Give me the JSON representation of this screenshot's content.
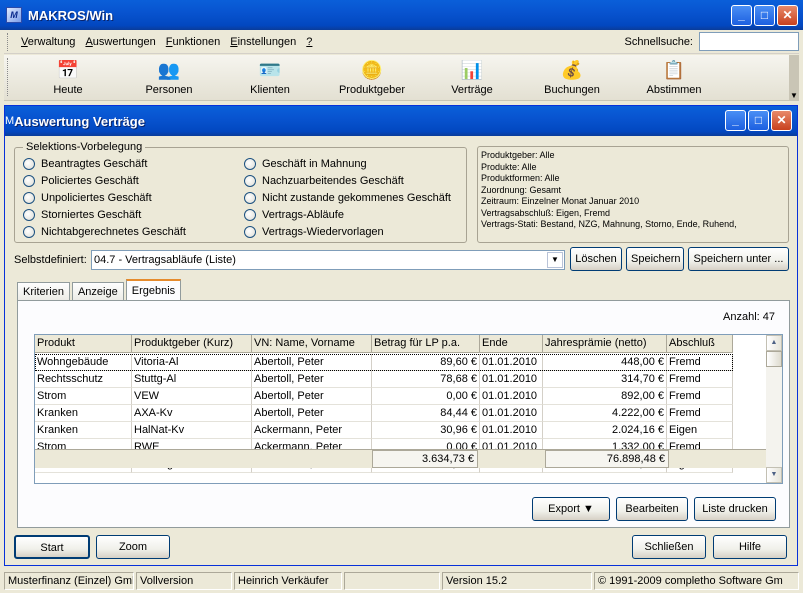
{
  "app": {
    "title": "MAKROS/Win",
    "icon": "makros-app-icon"
  },
  "menu": {
    "items": [
      {
        "label": "Verwaltung",
        "key": "V",
        "rest": "erwaltung"
      },
      {
        "label": "Auswertungen",
        "key": "A",
        "rest": "uswertungen"
      },
      {
        "label": "Funktionen",
        "key": "F",
        "rest": "unktionen"
      },
      {
        "label": "Einstellungen",
        "key": "E",
        "rest": "instellungen"
      },
      {
        "label": "?",
        "key": "?",
        "rest": ""
      }
    ],
    "quicksearch_label": "Schnellsuche:",
    "quicksearch_value": ""
  },
  "toolbar": {
    "items": [
      {
        "label": "Heute",
        "icon": "calendar-clock-icon"
      },
      {
        "label": "Personen",
        "icon": "people-icon"
      },
      {
        "label": "Klienten",
        "icon": "id-card-icon"
      },
      {
        "label": "Produktgeber",
        "icon": "coins-stack-icon"
      },
      {
        "label": "Verträge",
        "icon": "chart-document-icon"
      },
      {
        "label": "Buchungen",
        "icon": "money-icon"
      },
      {
        "label": "Abstimmen",
        "icon": "checklist-icon"
      }
    ]
  },
  "child": {
    "title": "Auswertung Verträge",
    "selection_legend": "Selektions-Vorbelegung",
    "radios_left": [
      "Beantragtes Geschäft",
      "Policiertes Geschäft",
      "Unpoliciertes Geschäft",
      "Storniertes Geschäft",
      "Nichtabgerechnetes Geschäft"
    ],
    "radios_right": [
      "Geschäft in Mahnung",
      "Nachzuarbeitendes Geschäft",
      "Nicht zustande gekommenes Geschäft",
      "Vertrags-Abläufe",
      "Vertrags-Wiedervorlagen"
    ],
    "summary": [
      "Produktgeber: Alle",
      "Produkte: Alle",
      "Produktformen: Alle",
      "Zuordnung: Gesamt",
      "Zeitraum: Einzelner Monat Januar 2010",
      "Vertragsabschluß: Eigen, Fremd",
      "Vertrags-Stati: Bestand, NZG, Mahnung, Storno, Ende, Ruhend,"
    ],
    "selbstdefiniert_label": "Selbstdefiniert:",
    "selbstdefiniert_value": "04.7 - Vertragsabläufe (Liste)",
    "btn_loeschen": "Löschen",
    "btn_speichern": "Speichern",
    "btn_speichern_unter": "Speichern unter ...",
    "tabs": [
      "Kriterien",
      "Anzeige",
      "Ergebnis"
    ],
    "active_tab": "Ergebnis",
    "anzahl": "Anzahl: 47",
    "columns": [
      "Produkt",
      "Produktgeber (Kurz)",
      "VN: Name, Vorname",
      "Betrag für LP p.a.",
      "Ende",
      "Jahresprämie (netto)",
      "Abschluß"
    ],
    "rows": [
      [
        "Wohngebäude",
        "Vitoria-Al",
        "Abertoll, Peter",
        "89,60 €",
        "01.01.2010",
        "448,00 €",
        "Fremd"
      ],
      [
        "Rechtsschutz",
        "Stuttg-Al",
        "Abertoll, Peter",
        "78,68 €",
        "01.01.2010",
        "314,70 €",
        "Fremd"
      ],
      [
        "Strom",
        "VEW",
        "Abertoll, Peter",
        "0,00 €",
        "01.01.2010",
        "892,00 €",
        "Fremd"
      ],
      [
        "Kranken",
        "AXA-Kv",
        "Abertoll, Peter",
        "84,44 €",
        "01.01.2010",
        "4.222,00 €",
        "Fremd"
      ],
      [
        "Kranken",
        "HalNat-Kv",
        "Ackermann, Peter",
        "30,96 €",
        "01.01.2010",
        "2.024,16 €",
        "Eigen"
      ],
      [
        "Strom",
        "RWE",
        "Ackermann, Peter",
        "0,00 €",
        "01.01.2010",
        "1.332,00 €",
        "Fremd"
      ],
      [
        "Rechtsschutz",
        "Dev-Alg-Al",
        "Ackermann, Peter",
        "79,20 €",
        "01.01.2010",
        "396,00 €",
        "Eigen"
      ]
    ],
    "total_betrag": "3.634,73 €",
    "total_praemie": "76.898,48 €",
    "btn_export": "Export",
    "btn_bearbeiten": "Bearbeiten",
    "btn_liste_drucken": "Liste drucken",
    "btn_start": "Start",
    "btn_zoom": "Zoom",
    "btn_schliessen": "Schließen",
    "btn_hilfe": "Hilfe"
  },
  "status": [
    "Musterfinanz (Einzel) Gmb",
    "Vollversion",
    "Heinrich Verkäufer",
    "",
    "Version 15.2",
    "© 1991-2009 completho Software Gm"
  ]
}
